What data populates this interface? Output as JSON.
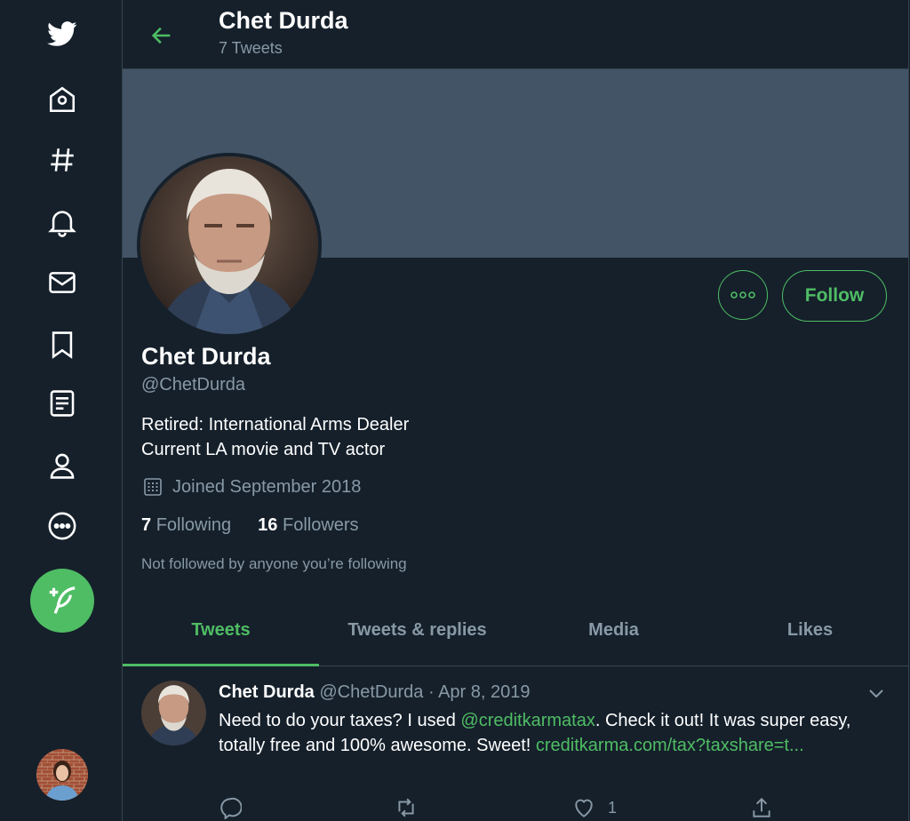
{
  "colors": {
    "background": "#15202b",
    "accent": "#4fbd64",
    "secondary_text": "#8899a6",
    "banner": "#425466",
    "border": "#38444d"
  },
  "sidebar": {
    "icons": [
      "twitter-logo-icon",
      "home-icon",
      "explore-hashtag-icon",
      "notifications-bell-icon",
      "messages-mail-icon",
      "bookmarks-icon",
      "lists-icon",
      "profile-icon",
      "more-icon"
    ],
    "compose_icon": "compose-tweet-icon"
  },
  "header": {
    "title": "Chet Durda",
    "subtitle": "7 Tweets"
  },
  "profile": {
    "name": "Chet Durda",
    "handle": "@ChetDurda",
    "bio_line1": "Retired: International Arms Dealer",
    "bio_line2": "Current LA movie and TV actor",
    "joined": "Joined September 2018",
    "following_count": "7",
    "following_label": "Following",
    "followers_count": "16",
    "followers_label": "Followers",
    "not_followed": "Not followed by anyone you’re following",
    "follow_label": "Follow"
  },
  "tabs": [
    {
      "label": "Tweets",
      "active": true
    },
    {
      "label": "Tweets & replies",
      "active": false
    },
    {
      "label": "Media",
      "active": false
    },
    {
      "label": "Likes",
      "active": false
    }
  ],
  "tweet": {
    "name": "Chet Durda",
    "handle": "@ChetDurda",
    "date": "Apr 8, 2019",
    "text_before": "Need to do your taxes? I used ",
    "mention": "@creditkarmatax",
    "text_after": ". Check it out! It was super easy, totally free and 100% awesome. Sweet! ",
    "link": "creditkarma.com/tax?taxshare=t...",
    "like_count": "1"
  }
}
